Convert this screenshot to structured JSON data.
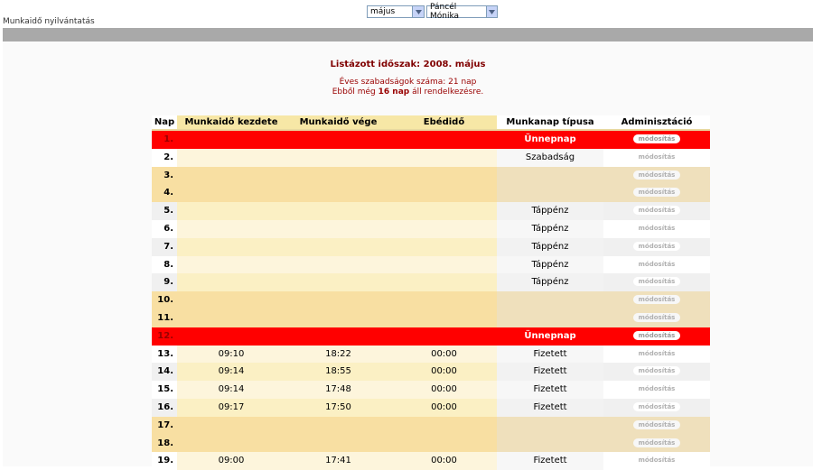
{
  "controls": {
    "month": {
      "selected": "május"
    },
    "person": {
      "selected": "Páncél Mónika"
    }
  },
  "app_title": "Munkaidő nyilvántatás",
  "summary": {
    "period": "Listázott időszak: 2008. május",
    "annual_leave": "Éves szabadságok száma: 21 nap",
    "remaining_prefix": "Ebből még",
    "remaining_days": "16 nap",
    "remaining_suffix": "áll rendelkezésre."
  },
  "table": {
    "headers": {
      "day": "Nap",
      "start": "Munkaidő kezdete",
      "end": "Munkaidő vége",
      "lunch": "Ebédidő",
      "type": "Munkanap típusa",
      "admin": "Adminisztáció"
    },
    "button_label": "módosítás",
    "rows": [
      {
        "day": "1.",
        "start": "",
        "end": "",
        "lunch": "",
        "type": "Ünnepnap",
        "kind": "holiday"
      },
      {
        "day": "2.",
        "start": "",
        "end": "",
        "lunch": "",
        "type": "Szabadság",
        "kind": "norm-b"
      },
      {
        "day": "3.",
        "start": "",
        "end": "",
        "lunch": "",
        "type": "",
        "kind": "weekend"
      },
      {
        "day": "4.",
        "start": "",
        "end": "",
        "lunch": "",
        "type": "",
        "kind": "weekend"
      },
      {
        "day": "5.",
        "start": "",
        "end": "",
        "lunch": "",
        "type": "Táppénz",
        "kind": "norm-a"
      },
      {
        "day": "6.",
        "start": "",
        "end": "",
        "lunch": "",
        "type": "Táppénz",
        "kind": "norm-b"
      },
      {
        "day": "7.",
        "start": "",
        "end": "",
        "lunch": "",
        "type": "Táppénz",
        "kind": "norm-a"
      },
      {
        "day": "8.",
        "start": "",
        "end": "",
        "lunch": "",
        "type": "Táppénz",
        "kind": "norm-b"
      },
      {
        "day": "9.",
        "start": "",
        "end": "",
        "lunch": "",
        "type": "Táppénz",
        "kind": "norm-a"
      },
      {
        "day": "10.",
        "start": "",
        "end": "",
        "lunch": "",
        "type": "",
        "kind": "weekend"
      },
      {
        "day": "11.",
        "start": "",
        "end": "",
        "lunch": "",
        "type": "",
        "kind": "weekend"
      },
      {
        "day": "12.",
        "start": "",
        "end": "",
        "lunch": "",
        "type": "Ünnepnap",
        "kind": "holiday"
      },
      {
        "day": "13.",
        "start": "09:10",
        "end": "18:22",
        "lunch": "00:00",
        "type": "Fizetett",
        "kind": "norm-b"
      },
      {
        "day": "14.",
        "start": "09:14",
        "end": "18:55",
        "lunch": "00:00",
        "type": "Fizetett",
        "kind": "norm-a"
      },
      {
        "day": "15.",
        "start": "09:14",
        "end": "17:48",
        "lunch": "00:00",
        "type": "Fizetett",
        "kind": "norm-b"
      },
      {
        "day": "16.",
        "start": "09:17",
        "end": "17:50",
        "lunch": "00:00",
        "type": "Fizetett",
        "kind": "norm-a"
      },
      {
        "day": "17.",
        "start": "",
        "end": "",
        "lunch": "",
        "type": "",
        "kind": "weekend"
      },
      {
        "day": "18.",
        "start": "",
        "end": "",
        "lunch": "",
        "type": "",
        "kind": "weekend"
      },
      {
        "day": "19.",
        "start": "09:00",
        "end": "17:41",
        "lunch": "00:00",
        "type": "Fizetett",
        "kind": "norm-b"
      }
    ]
  }
}
